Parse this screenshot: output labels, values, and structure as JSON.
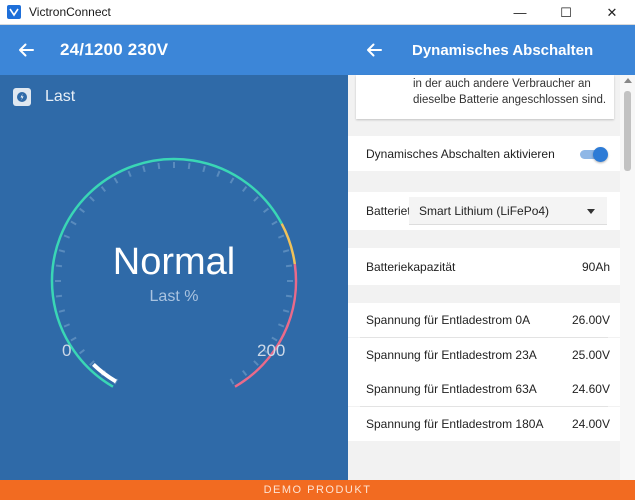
{
  "window": {
    "title": "VictronConnect",
    "minimize": "—",
    "maximize": "☐",
    "close": "✕"
  },
  "left": {
    "header_title": "24/1200 230V",
    "section_label": "Last",
    "gauge": {
      "status": "Normal",
      "subtitle": "Last %",
      "min_label": "0",
      "max_label": "200",
      "min": 0,
      "max": 200,
      "value": 0,
      "colors": {
        "normal": "#3ad6b5",
        "warning": "#f0c25a",
        "danger": "#ea6a8a",
        "needle": "#ffffff"
      }
    }
  },
  "right": {
    "header_title": "Dynamisches Abschalten",
    "info_text_line1": "in der auch andere Verbraucher an",
    "info_text_line2": "dieselbe Batterie angeschlossen sind.",
    "toggle_label": "Dynamisches Abschalten aktivieren",
    "toggle_on": true,
    "battery_label": "Batterietyp",
    "battery_value": "Smart Lithium (LiFePo4)",
    "capacity_label": "Batteriekapazität",
    "capacity_value": "90Ah",
    "voltages": [
      {
        "label": "Spannung für Entladestrom 0A",
        "value": "26.00V"
      },
      {
        "label": "Spannung für Entladestrom 23A",
        "value": "25.00V"
      },
      {
        "label": "Spannung für Entladestrom 63A",
        "value": "24.60V"
      },
      {
        "label": "Spannung für Entladestrom 180A",
        "value": "24.00V"
      }
    ]
  },
  "footer": {
    "demo_label": "DEMO PRODUKT"
  },
  "colors": {
    "header_blue": "#3c86d8",
    "panel_blue": "#2f6aa8",
    "demo_orange": "#f26b21",
    "toggle_blue": "#2d7bd6"
  }
}
